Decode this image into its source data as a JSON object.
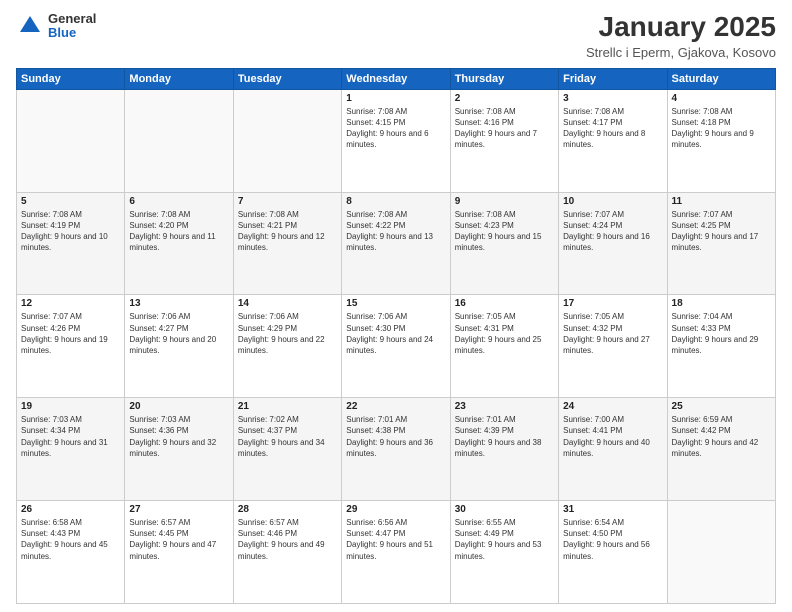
{
  "header": {
    "logo": {
      "general": "General",
      "blue": "Blue"
    },
    "title": "January 2025",
    "subtitle": "Strellc i Eperm, Gjakova, Kosovo"
  },
  "weekdays": [
    "Sunday",
    "Monday",
    "Tuesday",
    "Wednesday",
    "Thursday",
    "Friday",
    "Saturday"
  ],
  "weeks": [
    [
      {
        "day": "",
        "sunrise": "",
        "sunset": "",
        "daylight": ""
      },
      {
        "day": "",
        "sunrise": "",
        "sunset": "",
        "daylight": ""
      },
      {
        "day": "",
        "sunrise": "",
        "sunset": "",
        "daylight": ""
      },
      {
        "day": "1",
        "sunrise": "Sunrise: 7:08 AM",
        "sunset": "Sunset: 4:15 PM",
        "daylight": "Daylight: 9 hours and 6 minutes."
      },
      {
        "day": "2",
        "sunrise": "Sunrise: 7:08 AM",
        "sunset": "Sunset: 4:16 PM",
        "daylight": "Daylight: 9 hours and 7 minutes."
      },
      {
        "day": "3",
        "sunrise": "Sunrise: 7:08 AM",
        "sunset": "Sunset: 4:17 PM",
        "daylight": "Daylight: 9 hours and 8 minutes."
      },
      {
        "day": "4",
        "sunrise": "Sunrise: 7:08 AM",
        "sunset": "Sunset: 4:18 PM",
        "daylight": "Daylight: 9 hours and 9 minutes."
      }
    ],
    [
      {
        "day": "5",
        "sunrise": "Sunrise: 7:08 AM",
        "sunset": "Sunset: 4:19 PM",
        "daylight": "Daylight: 9 hours and 10 minutes."
      },
      {
        "day": "6",
        "sunrise": "Sunrise: 7:08 AM",
        "sunset": "Sunset: 4:20 PM",
        "daylight": "Daylight: 9 hours and 11 minutes."
      },
      {
        "day": "7",
        "sunrise": "Sunrise: 7:08 AM",
        "sunset": "Sunset: 4:21 PM",
        "daylight": "Daylight: 9 hours and 12 minutes."
      },
      {
        "day": "8",
        "sunrise": "Sunrise: 7:08 AM",
        "sunset": "Sunset: 4:22 PM",
        "daylight": "Daylight: 9 hours and 13 minutes."
      },
      {
        "day": "9",
        "sunrise": "Sunrise: 7:08 AM",
        "sunset": "Sunset: 4:23 PM",
        "daylight": "Daylight: 9 hours and 15 minutes."
      },
      {
        "day": "10",
        "sunrise": "Sunrise: 7:07 AM",
        "sunset": "Sunset: 4:24 PM",
        "daylight": "Daylight: 9 hours and 16 minutes."
      },
      {
        "day": "11",
        "sunrise": "Sunrise: 7:07 AM",
        "sunset": "Sunset: 4:25 PM",
        "daylight": "Daylight: 9 hours and 17 minutes."
      }
    ],
    [
      {
        "day": "12",
        "sunrise": "Sunrise: 7:07 AM",
        "sunset": "Sunset: 4:26 PM",
        "daylight": "Daylight: 9 hours and 19 minutes."
      },
      {
        "day": "13",
        "sunrise": "Sunrise: 7:06 AM",
        "sunset": "Sunset: 4:27 PM",
        "daylight": "Daylight: 9 hours and 20 minutes."
      },
      {
        "day": "14",
        "sunrise": "Sunrise: 7:06 AM",
        "sunset": "Sunset: 4:29 PM",
        "daylight": "Daylight: 9 hours and 22 minutes."
      },
      {
        "day": "15",
        "sunrise": "Sunrise: 7:06 AM",
        "sunset": "Sunset: 4:30 PM",
        "daylight": "Daylight: 9 hours and 24 minutes."
      },
      {
        "day": "16",
        "sunrise": "Sunrise: 7:05 AM",
        "sunset": "Sunset: 4:31 PM",
        "daylight": "Daylight: 9 hours and 25 minutes."
      },
      {
        "day": "17",
        "sunrise": "Sunrise: 7:05 AM",
        "sunset": "Sunset: 4:32 PM",
        "daylight": "Daylight: 9 hours and 27 minutes."
      },
      {
        "day": "18",
        "sunrise": "Sunrise: 7:04 AM",
        "sunset": "Sunset: 4:33 PM",
        "daylight": "Daylight: 9 hours and 29 minutes."
      }
    ],
    [
      {
        "day": "19",
        "sunrise": "Sunrise: 7:03 AM",
        "sunset": "Sunset: 4:34 PM",
        "daylight": "Daylight: 9 hours and 31 minutes."
      },
      {
        "day": "20",
        "sunrise": "Sunrise: 7:03 AM",
        "sunset": "Sunset: 4:36 PM",
        "daylight": "Daylight: 9 hours and 32 minutes."
      },
      {
        "day": "21",
        "sunrise": "Sunrise: 7:02 AM",
        "sunset": "Sunset: 4:37 PM",
        "daylight": "Daylight: 9 hours and 34 minutes."
      },
      {
        "day": "22",
        "sunrise": "Sunrise: 7:01 AM",
        "sunset": "Sunset: 4:38 PM",
        "daylight": "Daylight: 9 hours and 36 minutes."
      },
      {
        "day": "23",
        "sunrise": "Sunrise: 7:01 AM",
        "sunset": "Sunset: 4:39 PM",
        "daylight": "Daylight: 9 hours and 38 minutes."
      },
      {
        "day": "24",
        "sunrise": "Sunrise: 7:00 AM",
        "sunset": "Sunset: 4:41 PM",
        "daylight": "Daylight: 9 hours and 40 minutes."
      },
      {
        "day": "25",
        "sunrise": "Sunrise: 6:59 AM",
        "sunset": "Sunset: 4:42 PM",
        "daylight": "Daylight: 9 hours and 42 minutes."
      }
    ],
    [
      {
        "day": "26",
        "sunrise": "Sunrise: 6:58 AM",
        "sunset": "Sunset: 4:43 PM",
        "daylight": "Daylight: 9 hours and 45 minutes."
      },
      {
        "day": "27",
        "sunrise": "Sunrise: 6:57 AM",
        "sunset": "Sunset: 4:45 PM",
        "daylight": "Daylight: 9 hours and 47 minutes."
      },
      {
        "day": "28",
        "sunrise": "Sunrise: 6:57 AM",
        "sunset": "Sunset: 4:46 PM",
        "daylight": "Daylight: 9 hours and 49 minutes."
      },
      {
        "day": "29",
        "sunrise": "Sunrise: 6:56 AM",
        "sunset": "Sunset: 4:47 PM",
        "daylight": "Daylight: 9 hours and 51 minutes."
      },
      {
        "day": "30",
        "sunrise": "Sunrise: 6:55 AM",
        "sunset": "Sunset: 4:49 PM",
        "daylight": "Daylight: 9 hours and 53 minutes."
      },
      {
        "day": "31",
        "sunrise": "Sunrise: 6:54 AM",
        "sunset": "Sunset: 4:50 PM",
        "daylight": "Daylight: 9 hours and 56 minutes."
      },
      {
        "day": "",
        "sunrise": "",
        "sunset": "",
        "daylight": ""
      }
    ]
  ]
}
